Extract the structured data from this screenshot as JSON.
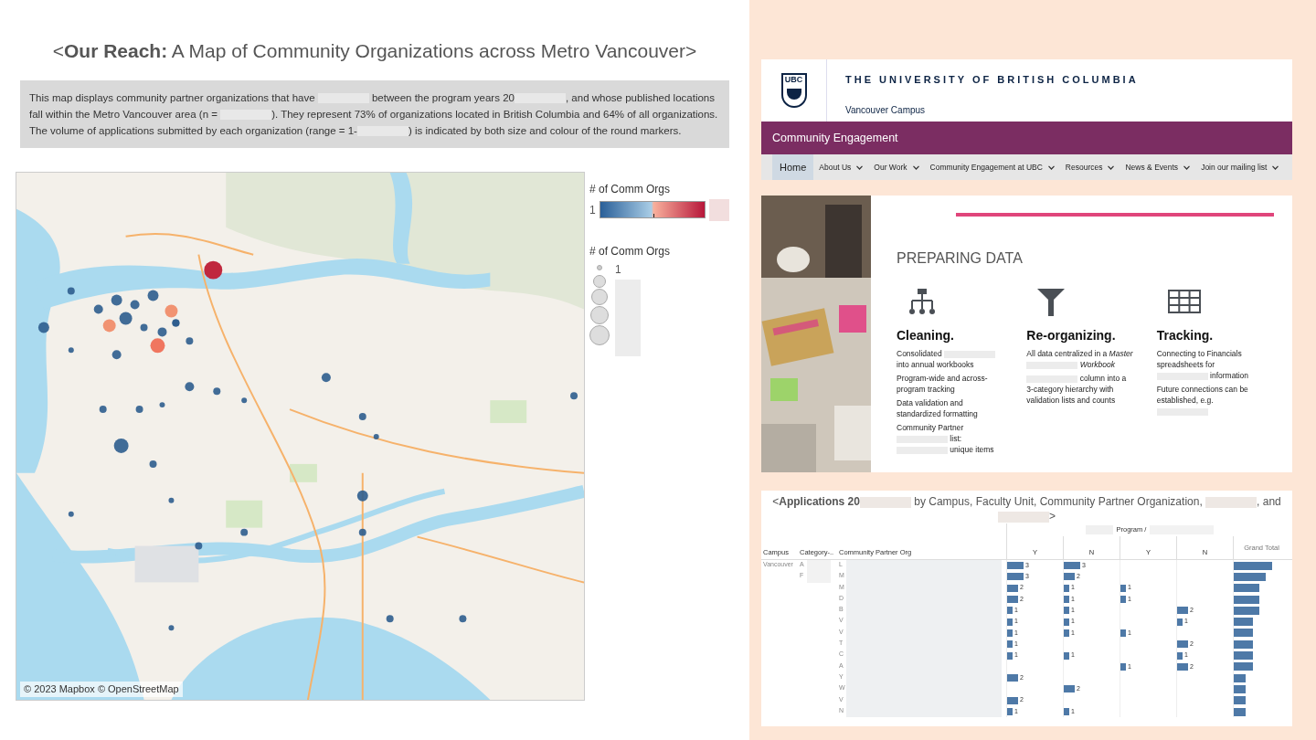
{
  "title": "<**Our Reach:** A Map of Community Organizations across Metro Vancouver>",
  "description": [
    {
      "kind": "text",
      "text": "This map displays community partner organizations that have "
    },
    {
      "kind": "redaction"
    },
    {
      "kind": "text",
      "text": " between the program years 20"
    },
    {
      "kind": "redaction"
    },
    {
      "kind": "text",
      "text": ", and whose published locations fall within the Metro Vancouver area (n = "
    },
    {
      "kind": "redaction"
    },
    {
      "kind": "text",
      "text": "). They represent 73% of organizations located in British Columbia and 64% of all organizations. The volume of applications submitted by each organization (range = 1-"
    },
    {
      "kind": "redaction"
    },
    {
      "kind": "text",
      "text": ") is indicated by both size and colour of the round markers."
    }
  ],
  "map": {
    "kind": "picture",
    "attribution": "© 2023 Mapbox © OpenStreetMap"
  },
  "color_legend": {
    "title": "# of Comm Orgs",
    "min_label": "1"
  },
  "size_legend": {
    "title": "# of Comm Orgs",
    "min_label": "1"
  },
  "ubc": {
    "logo_text": "UBC",
    "university": "THE UNIVERSITY OF BRITISH COLUMBIA",
    "campus": "Vancouver Campus",
    "banner": "Community Engagement",
    "nav": [
      {
        "label": "Home",
        "selected": true,
        "has_menu": false
      },
      {
        "label": "About Us",
        "selected": false,
        "has_menu": true
      },
      {
        "label": "Our Work",
        "selected": false,
        "has_menu": true
      },
      {
        "label": "Community Engagement at UBC",
        "selected": false,
        "has_menu": true
      },
      {
        "label": "Resources",
        "selected": false,
        "has_menu": true
      },
      {
        "label": "News & Events",
        "selected": false,
        "has_menu": true
      },
      {
        "label": "Join our mailing list",
        "selected": false,
        "has_menu": true
      }
    ]
  },
  "preparing": {
    "heading": "PREPARING DATA",
    "columns": [
      {
        "kind": "hierarchy",
        "title": "Cleaning.",
        "items": [
          [
            {
              "kind": "text",
              "text": "Consolidated "
            },
            {
              "kind": "redaction"
            },
            {
              "kind": "text",
              "text": " into annual workbooks"
            }
          ],
          [
            {
              "kind": "text",
              "text": "Program-wide and across-program tracking"
            }
          ],
          [
            {
              "kind": "text",
              "text": "Data validation and standardized formatting"
            }
          ],
          [
            {
              "kind": "text",
              "text": "Community Partner "
            },
            {
              "kind": "redaction"
            },
            {
              "kind": "text",
              "text": " list: "
            },
            {
              "kind": "redaction"
            },
            {
              "kind": "text",
              "text": " unique items"
            }
          ]
        ]
      },
      {
        "kind": "funnel",
        "title": "Re-organizing.",
        "items": [
          [
            {
              "kind": "text",
              "text": "All data centralized in a *Master* "
            },
            {
              "kind": "redaction"
            },
            {
              "kind": "text",
              "text": " *Workbook*"
            }
          ],
          [
            {
              "kind": "redaction"
            },
            {
              "kind": "text",
              "text": " column into a 3-category hierarchy with validation lists and counts"
            }
          ]
        ]
      },
      {
        "kind": "grid",
        "title": "Tracking.",
        "items": [
          [
            {
              "kind": "text",
              "text": "Connecting to Financials spreadsheets for "
            },
            {
              "kind": "redaction"
            },
            {
              "kind": "text",
              "text": " information"
            }
          ],
          [
            {
              "kind": "text",
              "text": "Future connections can be established, e.g. "
            },
            {
              "kind": "redaction"
            }
          ]
        ]
      }
    ]
  },
  "applications": {
    "title": [
      {
        "kind": "text",
        "text": "<**Applications 20**"
      },
      {
        "kind": "redaction"
      },
      {
        "kind": "text",
        "text": " by Campus, Faculty Unit, Community Partner Organization, "
      },
      {
        "kind": "redaction"
      },
      {
        "kind": "text",
        "text": ", and "
      },
      {
        "kind": "redaction"
      },
      {
        "kind": "text",
        "text": ">"
      }
    ],
    "group_header": "Program /",
    "columns": [
      "Campus",
      "Category-..",
      "Community Partner Org",
      "Y",
      "N",
      "Y",
      "N",
      "Grand Total"
    ],
    "rows": [
      {
        "campus": "Vancouver",
        "category": "A",
        "org": "L",
        "cells": {
          "col_1": "3",
          "col_2": "3"
        },
        "level": 0.7
      },
      {
        "category": "F",
        "org": "M",
        "cells": {
          "col_1": "3",
          "col_2": "2"
        },
        "level": 0.58
      },
      {
        "org": "M",
        "cells": {
          "col_1": "2",
          "col_2": "1",
          "col_3": "1"
        },
        "level": 0.46
      },
      {
        "org": "D",
        "cells": {
          "col_1": "2",
          "col_2": "1",
          "col_3": "1"
        },
        "level": 0.46
      },
      {
        "org": "B",
        "cells": {
          "col_1": "1",
          "col_2": "1",
          "col_4": "2"
        },
        "level": 0.46
      },
      {
        "org": "V",
        "cells": {
          "col_1": "1",
          "col_2": "1",
          "col_4": "1"
        },
        "level": 0.35
      },
      {
        "org": "V",
        "cells": {
          "col_1": "1",
          "col_2": "1",
          "col_3": "1"
        },
        "level": 0.35
      },
      {
        "org": "T",
        "cells": {
          "col_1": "1",
          "col_4": "2"
        },
        "level": 0.35
      },
      {
        "org": "C",
        "cells": {
          "col_1": "1",
          "col_2": "1",
          "col_4": "1"
        },
        "level": 0.35
      },
      {
        "org": "A",
        "cells": {
          "col_3": "1",
          "col_4": "2"
        },
        "level": 0.35
      },
      {
        "org": "Y",
        "cells": {
          "col_1": "2"
        },
        "level": 0.22
      },
      {
        "org": "W",
        "cells": {
          "col_2": "2"
        },
        "level": 0.22
      },
      {
        "org": "V",
        "cells": {
          "col_1": "2"
        },
        "level": 0.22
      },
      {
        "org": "N",
        "cells": {
          "col_1": "1",
          "col_2": "1"
        },
        "level": 0.22
      }
    ]
  }
}
